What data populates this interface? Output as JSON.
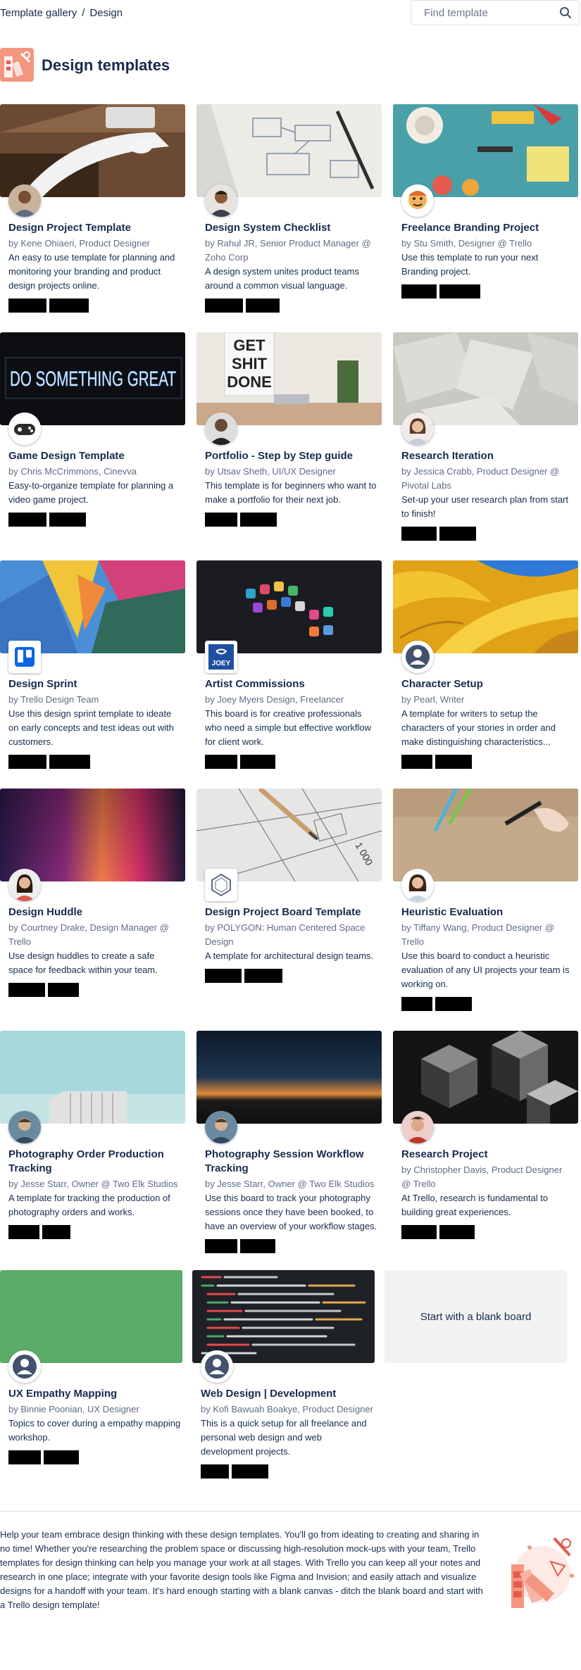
{
  "breadcrumb": {
    "gallery": "Template gallery",
    "separator": "/",
    "current": "Design"
  },
  "search": {
    "placeholder": "Find template"
  },
  "category": {
    "title": "Design templates"
  },
  "cards": [
    {
      "title": "Design Project Template",
      "author": "by Kene Ohiaeri, Product Designer",
      "description": "An easy to use template for planning and monitoring your branding and product design projects online."
    },
    {
      "title": "Design System Checklist",
      "author": "by Rahul JR, Senior Product Manager @ Zoho Corp",
      "description": "A design system unites product teams around a common visual language."
    },
    {
      "title": "Freelance Branding Project",
      "author": "by Stu Smith, Designer @ Trello",
      "description": "Use this template to run your next Branding project."
    },
    {
      "title": "Game Design Template",
      "author": "by Chris McCrimmons, Cinevva",
      "description": "Easy-to-organize template for planning a video game project.",
      "image_text": "DO SOMETHING GREAT"
    },
    {
      "title": "Portfolio - Step by Step guide",
      "author": "by Utsav Sheth, UI/UX Designer",
      "description": "This template is for beginners who want to make a portfolio for their next job.",
      "image_text": [
        "GET",
        "SHIT",
        "DONE"
      ]
    },
    {
      "title": "Research Iteration",
      "author": "by Jessica Crabb, Product Designer @ Pivotal Labs",
      "description": "Set-up your user research plan from start to finish!"
    },
    {
      "title": "Design Sprint",
      "author": "by Trello Design Team",
      "description": "Use this design sprint template to ideate on early concepts and test ideas out with customers."
    },
    {
      "title": "Artist Commissions",
      "author": "by Joey Myers Design, Freelancer",
      "description": "This board is for creative professionals who need a simple but effective workflow for client work.",
      "avatar_text": "JOEY"
    },
    {
      "title": "Character Setup",
      "author": "by Pearl, Writer",
      "description": "A template for writers to setup the characters of your stories in order and make distinguishing characteristics..."
    },
    {
      "title": "Design Huddle",
      "author": "by Courtney Drake, Design Manager @ Trello",
      "description": "Use design huddles to create a safe space for feedback within your team."
    },
    {
      "title": "Design Project Board Template",
      "author": "by POLYGON: Human Centered Space Design",
      "description": "A template for architectural design teams.",
      "image_text": "1 000"
    },
    {
      "title": "Heuristic Evaluation",
      "author": "by Tiffany Wang, Product Designer @ Trello",
      "description": "Use this board to conduct a heuristic evaluation of any UI projects your team is working on."
    },
    {
      "title": "Photography Order Production Tracking",
      "author": "by Jesse Starr, Owner @ Two Elk Studios",
      "description": "A template for tracking the production of photography orders and works."
    },
    {
      "title": "Photography Session Workflow Tracking",
      "author": "by Jesse Starr, Owner @ Two Elk Studios",
      "description": "Use this board to track your photography sessions once they have been booked, to have an overview of your workflow stages."
    },
    {
      "title": "Research Project",
      "author": "by Christopher Davis, Product Designer @ Trello",
      "description": "At Trello, research is fundamental to building great experiences."
    },
    {
      "title": "UX Empathy Mapping",
      "author": "by Binnie Poonian, UX Designer",
      "description": "Topics to cover during a empathy mapping workshop."
    },
    {
      "title": "Web Design | Development",
      "author": "by Kofi Bawuah Boakye, Product Designer",
      "description": "This is a quick setup for all freelance and personal web design and web development projects."
    }
  ],
  "blank_board": {
    "label": "Start with a blank board"
  },
  "footer": {
    "text": "Help your team embrace design thinking with these design templates. You'll go from ideating to creating and sharing in no time! Whether you're researching the problem space or discussing high-resolution mock-ups with your team, Trello templates for design thinking can help you manage your work at all stages. With Trello you can keep all your notes and research in one place; integrate with your favorite design tools like Figma and Invision; and easily attach and visualize designs for a handoff with your team. It's hard enough starting with a blank canvas - ditch the blank board and start with a Trello design template!"
  },
  "colors": {
    "text": "#172b4d",
    "muted": "#5e6c84",
    "blank_bg": "#f1f2f4",
    "accent": "#f4967f"
  },
  "icons": {
    "search": "magnifier-icon",
    "category": "design-category-icon"
  }
}
